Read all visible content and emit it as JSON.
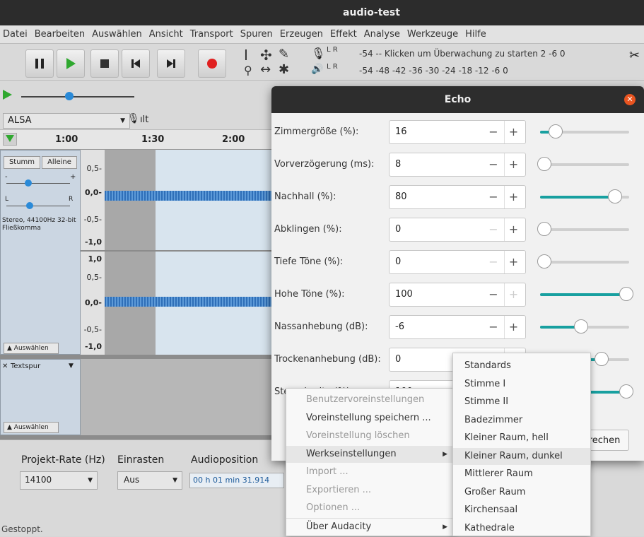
{
  "app": {
    "title": "audio-test"
  },
  "menu": [
    "Datei",
    "Bearbeiten",
    "Auswählen",
    "Ansicht",
    "Transport",
    "Spuren",
    "Erzeugen",
    "Effekt",
    "Analyse",
    "Werkzeuge",
    "Hilfe"
  ],
  "meters": {
    "rec_scale": "-54  --  Klicken um Überwachung zu starten 2  -6  0",
    "play_scale": "-54  -48  -42  -36  -30  -24  -18  -12  -6  0",
    "rec_lr": "L R",
    "play_lr": "L R"
  },
  "device": {
    "host": "ALSA",
    "input": "ılt"
  },
  "ruler": {
    "t1": "1:00",
    "t2": "1:30",
    "t3": "2:00"
  },
  "track": {
    "mute": "Stumm",
    "solo": "Alleine",
    "info": "Stereo, 44100Hz 32-bit Fließkomma",
    "select": "Auswählen",
    "gain_minus": "-",
    "gain_plus": "+",
    "pan_l": "L",
    "pan_r": "R"
  },
  "scale": {
    "a": [
      "0,5-",
      "0,0-",
      "-0,5-",
      "-1,0"
    ],
    "b": [
      "1,0",
      "0,5-",
      "0,0-",
      "-0,5-",
      "-1,0"
    ]
  },
  "label_track": {
    "name": "Textspur",
    "select": "Auswählen"
  },
  "bottom": {
    "rate_label": "Projekt-Rate (Hz)",
    "rate_value": "14100",
    "snap_label": "Einrasten",
    "snap_value": "Aus",
    "pos_label": "Audioposition",
    "pos_value": "00 h 01 min 31.914"
  },
  "status": "Gestoppt.",
  "echo": {
    "title": "Echo",
    "params": [
      {
        "label": "Zimmergröße (%):",
        "value": "16",
        "level": 0.14,
        "minus_enabled": true,
        "plus_enabled": true
      },
      {
        "label": "Vorverzögerung (ms):",
        "value": "8",
        "level": 0.0,
        "minus_enabled": true,
        "plus_enabled": true
      },
      {
        "label": "Nachhall (%):",
        "value": "80",
        "level": 0.86,
        "minus_enabled": true,
        "plus_enabled": true
      },
      {
        "label": "Abklingen (%):",
        "value": "0",
        "level": 0.0,
        "minus_enabled": false,
        "plus_enabled": true
      },
      {
        "label": "Tiefe Töne (%):",
        "value": "0",
        "level": 0.0,
        "minus_enabled": false,
        "plus_enabled": true
      },
      {
        "label": "Hohe Töne (%):",
        "value": "100",
        "level": 1.0,
        "minus_enabled": true,
        "plus_enabled": false
      },
      {
        "label": "Nassanhebung (dB):",
        "value": "-6",
        "level": 0.45,
        "minus_enabled": true,
        "plus_enabled": true
      },
      {
        "label": "Trockenanhebung (dB):",
        "value": "0",
        "level": 0.7,
        "minus_enabled": true,
        "plus_enabled": true
      },
      {
        "label": "Stereobreite (%):",
        "value": "100",
        "level": 1.0,
        "minus_enabled": true,
        "plus_enabled": true
      }
    ],
    "button_partial": "rechen"
  },
  "context_menu": [
    {
      "label": "Benutzervoreinstellungen",
      "disabled": true,
      "submenu": false
    },
    {
      "label": "Voreinstellung speichern ...",
      "disabled": false,
      "submenu": false
    },
    {
      "label": "Voreinstellung löschen",
      "disabled": true,
      "submenu": false
    },
    {
      "label": "Werkseinstellungen",
      "disabled": false,
      "submenu": true,
      "highlight": true
    },
    {
      "label": "Import ...",
      "disabled": true,
      "submenu": false
    },
    {
      "label": "Exportieren ...",
      "disabled": true,
      "submenu": false
    },
    {
      "label": "Optionen ...",
      "disabled": true,
      "submenu": false
    },
    {
      "label": "Über Audacity",
      "disabled": false,
      "submenu": true
    }
  ],
  "factory_presets": [
    "Standards",
    "Stimme I",
    "Stimme II",
    "Badezimmer",
    "Kleiner Raum, hell",
    "Kleiner Raum, dunkel",
    "Mittlerer Raum",
    "Großer Raum",
    "Kirchensaal",
    "Kathedrale"
  ],
  "factory_selected": "Kleiner Raum, dunkel"
}
